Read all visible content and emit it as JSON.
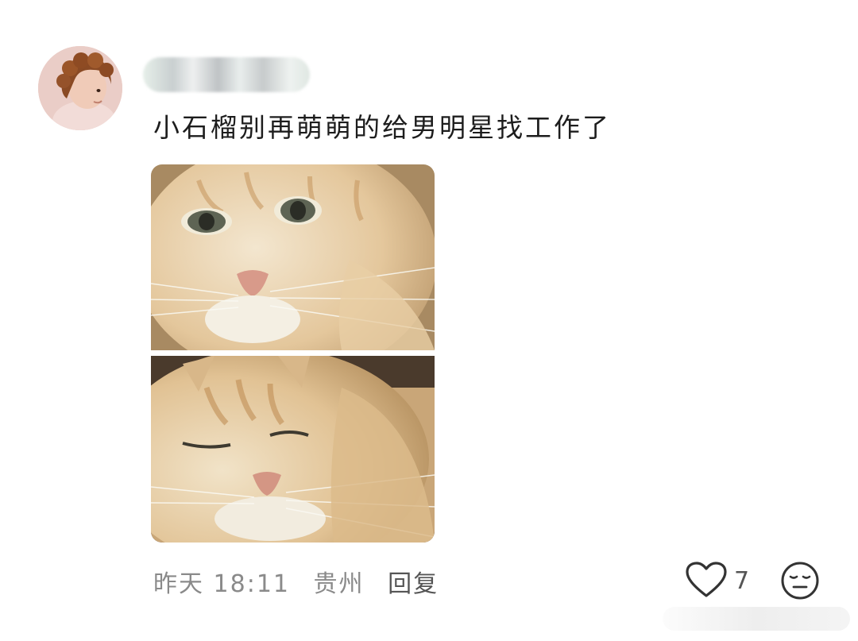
{
  "comment": {
    "username": "",
    "text": "小石榴别再萌萌的给男明星找工作了",
    "time": "昨天 18:11",
    "location": "贵州",
    "reply_label": "回复",
    "like_count": "7"
  },
  "icons": {
    "like": "heart-outline-icon",
    "emoji": "neutral-face-icon"
  },
  "colors": {
    "text_primary": "#1d1d1d",
    "text_meta": "#8a8a8a",
    "background": "#ffffff"
  }
}
